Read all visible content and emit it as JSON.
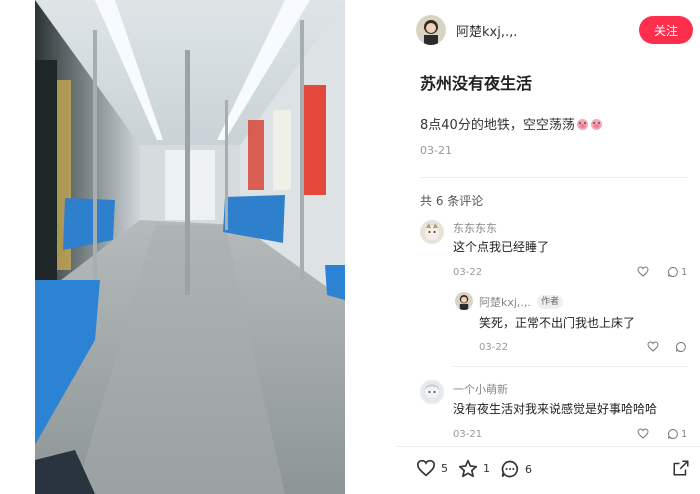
{
  "author": {
    "name": "阿楚kxj,.,.",
    "avatar_icon": "girl-avatar-icon"
  },
  "follow_label": "关注",
  "post": {
    "title": "苏州没有夜生活",
    "description": "8点40分的地铁，空空荡荡",
    "description_emojis": [
      "pig-face-emoji",
      "pig-face-emoji"
    ],
    "date": "03-21"
  },
  "comments_summary": "共 6 条评论",
  "comments": [
    {
      "name": "东东东东",
      "text": "这个点我已经睡了",
      "date": "03-22",
      "likes_icon": "heart-icon",
      "replies": "1",
      "avatar_icon": "cat-avatar-icon"
    },
    {
      "name": "阿楚kxj,.,.",
      "badge": "作者",
      "text": "笑死，正常不出门我也上床了",
      "date": "03-22",
      "avatar_icon": "girl-avatar-icon"
    },
    {
      "name": "一个小萌新",
      "text": "没有夜生活对我来说感觉是好事哈哈哈",
      "date": "03-21",
      "replies": "1",
      "avatar_icon": "anime-avatar-icon"
    }
  ],
  "actions": {
    "likes": "5",
    "favorites": "1",
    "comments": "6"
  },
  "colors": {
    "accent": "#ff2e4d",
    "seat_blue": "#3a8ed6"
  }
}
